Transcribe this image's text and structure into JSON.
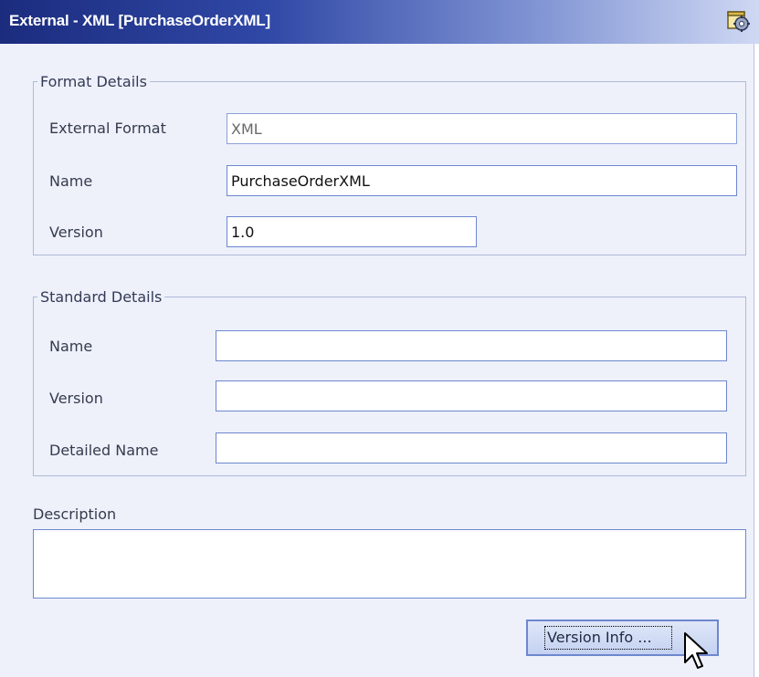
{
  "window": {
    "title": "External - XML [PurchaseOrderXML]",
    "title_icon": "window-gear-icon"
  },
  "format_details": {
    "legend": "Format Details",
    "external_format": {
      "label": "External Format",
      "value": "XML"
    },
    "name": {
      "label": "Name",
      "value": "PurchaseOrderXML"
    },
    "version": {
      "label": "Version",
      "value": "1.0"
    }
  },
  "standard_details": {
    "legend": "Standard Details",
    "name": {
      "label": "Name",
      "value": ""
    },
    "version": {
      "label": "Version",
      "value": ""
    },
    "detailed_name": {
      "label": "Detailed Name",
      "value": ""
    }
  },
  "description": {
    "label": "Description",
    "value": ""
  },
  "buttons": {
    "version_info": "Version Info ..."
  },
  "colors": {
    "title_gradient_start": "#1b2c7e",
    "panel_background": "#eef1fa",
    "field_border": "#6d87cf"
  }
}
